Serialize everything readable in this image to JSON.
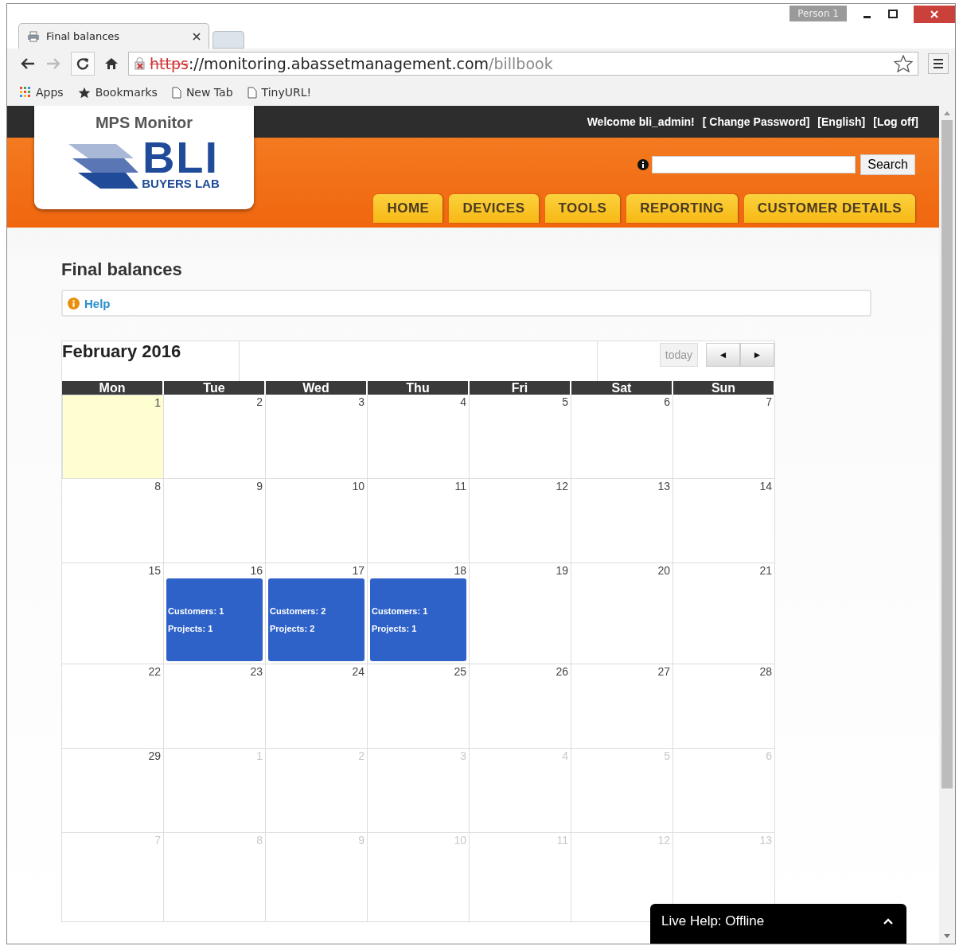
{
  "browser": {
    "profile": "Person 1",
    "tab": {
      "title": "Final balances"
    },
    "url": {
      "scheme": "https",
      "insecure": true,
      "host": "://monitoring.abassetmanagement.com",
      "path": "/billbook"
    },
    "bookmarks": [
      {
        "kind": "apps",
        "label": "Apps"
      },
      {
        "kind": "star",
        "label": "Bookmarks"
      },
      {
        "kind": "page",
        "label": "New Tab"
      },
      {
        "kind": "page",
        "label": "TinyURL!"
      }
    ]
  },
  "header": {
    "product": "MPS Monitor",
    "logo_main": "BLI",
    "logo_sub": "BUYERS LAB",
    "welcome": "Welcome bli_admin!",
    "links": [
      "[ Change Password]",
      "[English]",
      "[Log off]"
    ],
    "search_button": "Search",
    "nav": [
      {
        "label": "HOME",
        "selected": false
      },
      {
        "label": "DEVICES",
        "selected": false
      },
      {
        "label": "TOOLS",
        "selected": false
      },
      {
        "label": "REPORTING",
        "selected": false
      },
      {
        "label": "CUSTOMER DETAILS",
        "selected": false
      }
    ]
  },
  "page": {
    "title": "Final balances",
    "help": "Help"
  },
  "calendar": {
    "title": "February 2016",
    "today_button": "today",
    "prev": "◄",
    "next": "►",
    "weekdays": [
      "Mon",
      "Tue",
      "Wed",
      "Thu",
      "Fri",
      "Sat",
      "Sun"
    ],
    "weeks": [
      [
        {
          "label": "1",
          "other_month": false,
          "today": true
        },
        {
          "label": "2",
          "other_month": false,
          "today": false
        },
        {
          "label": "3",
          "other_month": false,
          "today": false
        },
        {
          "label": "4",
          "other_month": false,
          "today": false
        },
        {
          "label": "5",
          "other_month": false,
          "today": false
        },
        {
          "label": "6",
          "other_month": false,
          "today": false
        },
        {
          "label": "7",
          "other_month": false,
          "today": false
        }
      ],
      [
        {
          "label": "8",
          "other_month": false,
          "today": false
        },
        {
          "label": "9",
          "other_month": false,
          "today": false
        },
        {
          "label": "10",
          "other_month": false,
          "today": false
        },
        {
          "label": "11",
          "other_month": false,
          "today": false
        },
        {
          "label": "12",
          "other_month": false,
          "today": false
        },
        {
          "label": "13",
          "other_month": false,
          "today": false
        },
        {
          "label": "14",
          "other_month": false,
          "today": false
        }
      ],
      [
        {
          "label": "15",
          "other_month": false,
          "today": false
        },
        {
          "label": "16",
          "other_month": false,
          "today": false,
          "events": [
            {
              "lines": [
                "Customers: 1",
                "Projects: 1"
              ]
            }
          ]
        },
        {
          "label": "17",
          "other_month": false,
          "today": false,
          "events": [
            {
              "lines": [
                "Customers: 2",
                "Projects: 2"
              ]
            }
          ]
        },
        {
          "label": "18",
          "other_month": false,
          "today": false,
          "events": [
            {
              "lines": [
                "Customers: 1",
                "Projects: 1"
              ]
            }
          ]
        },
        {
          "label": "19",
          "other_month": false,
          "today": false
        },
        {
          "label": "20",
          "other_month": false,
          "today": false
        },
        {
          "label": "21",
          "other_month": false,
          "today": false
        }
      ],
      [
        {
          "label": "22",
          "other_month": false,
          "today": false
        },
        {
          "label": "23",
          "other_month": false,
          "today": false
        },
        {
          "label": "24",
          "other_month": false,
          "today": false
        },
        {
          "label": "25",
          "other_month": false,
          "today": false
        },
        {
          "label": "26",
          "other_month": false,
          "today": false
        },
        {
          "label": "27",
          "other_month": false,
          "today": false
        },
        {
          "label": "28",
          "other_month": false,
          "today": false
        }
      ],
      [
        {
          "label": "29",
          "other_month": false,
          "today": false
        },
        {
          "label": "1",
          "other_month": true,
          "today": false
        },
        {
          "label": "2",
          "other_month": true,
          "today": false
        },
        {
          "label": "3",
          "other_month": true,
          "today": false
        },
        {
          "label": "4",
          "other_month": true,
          "today": false
        },
        {
          "label": "5",
          "other_month": true,
          "today": false
        },
        {
          "label": "6",
          "other_month": true,
          "today": false
        }
      ],
      [
        {
          "label": "7",
          "other_month": true,
          "today": false
        },
        {
          "label": "8",
          "other_month": true,
          "today": false
        },
        {
          "label": "9",
          "other_month": true,
          "today": false
        },
        {
          "label": "10",
          "other_month": true,
          "today": false
        },
        {
          "label": "11",
          "other_month": true,
          "today": false
        },
        {
          "label": "12",
          "other_month": true,
          "today": false
        },
        {
          "label": "13",
          "other_month": true,
          "today": false
        }
      ]
    ]
  },
  "live_help": {
    "label": "Live Help: Offline",
    "expanded": false
  }
}
